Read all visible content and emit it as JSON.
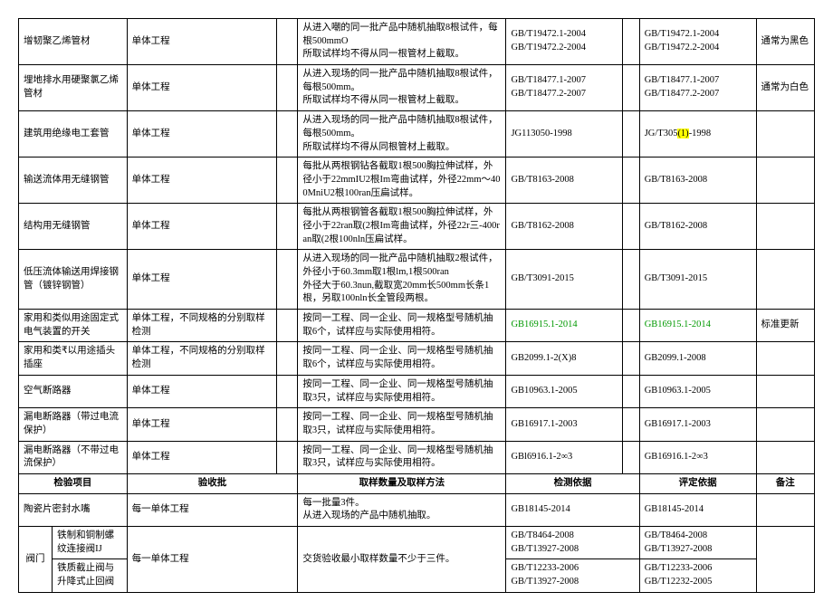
{
  "rows": [
    {
      "c1": "增韧聚乙烯管材",
      "c2": "单体工程",
      "c4": "从进入嘲的同一批产品中随机抽取8根试件，每根500mmO\n所取试样均不得从同一根管材上截取。",
      "c5": "GB/T19472.1-2004\nGB/T19472.2-2004",
      "c7": "GB/T19472.1-2004\nGB/T19472.2-2004",
      "c8": "通常为黑色"
    },
    {
      "c1": "埋地排水用硬聚氯乙烯管材",
      "c2": "单体工程",
      "c4": "从进入现场的同一批产品中随机抽取8根试件，每根500mm。\n所取试样均不得从同一根管材上截取。",
      "c5": "GB/T18477.1-2007\nGB/T18477.2-2007",
      "c7": "GB/T18477.1-2007\nGB/T18477.2-2007",
      "c8": "通常为白色"
    },
    {
      "c1": "建筑用绝缘电工套管",
      "c2": "单体工程",
      "c4": "从进入现场的同一批产品中随机抽取8根试件，每根500mm。\n所取试样均不得从同根管材上截取。",
      "c5": "JG113050-1998",
      "c7": "JG/T305(1)-1998",
      "c7_highlight": true,
      "c8": ""
    },
    {
      "c1": "输送流体用无缝钢管",
      "c2": "单体工程",
      "c4": "每批从两根钢钻各截取1根500胸拉伸试样，外径小于22mmIU2根Im弯曲试样，外径22mm～400MniU2根100ran压扁试样。",
      "c5": "GB/T8163-2008",
      "c7": "GB/T8163-2008",
      "c8": ""
    },
    {
      "c1": "结构用无缝钢管",
      "c2": "单体工程",
      "c4": "每批从两根钢管各截取1根500胸拉伸试样，外径小于22ran取(2根Im弯曲试样，外径22r三-400ran取(2根100nln压扁试样。",
      "c5": "GB/T8162-2008",
      "c7": "GB/T8162-2008",
      "c8": ""
    },
    {
      "c1": "低压流体输送用焊接钢管（镀锌钢管）",
      "c2": "单体工程",
      "c4": "从进入现场的同一批产品中随机抽取2根试件，外径小于60.3mm取1根lm,1根500ran\n外径大于60.3nun,截取宽20mm长500mm长条1根，另取100nln长全管段两根。",
      "c5": "GB/T3091-2015",
      "c7": "GB/T3091-2015",
      "c8": ""
    },
    {
      "c1": "家用和类似用途固定式电气装置的开关",
      "c2": "单体工程，不同规格的分别取样检测",
      "c4": "按同一工程、同一企业、同一规格型号随机抽取6个，试样应与实际使用相符。",
      "c5": "GB16915.1-2014",
      "c5_green": true,
      "c7": "GB16915.1-2014",
      "c7_green": true,
      "c8": "标准更新"
    },
    {
      "c1": "家用和类₹以用途插头插座",
      "c2": "单体工程，不同规格的分别取样检测",
      "c4": "按同一工程、同一企业、同一规格型号随机抽取6个，试样应与实际使用相符。",
      "c5": "GB2099.1-2(X)8",
      "c7": "GB2099.1-2008",
      "c8": ""
    },
    {
      "c1": "空气断路器",
      "c2": "单体工程",
      "c4": "按同一工程、同一企业、同一规格型号随机抽取3只，试样应与实际使用相符。",
      "c5": "GB10963.1-2005",
      "c7": "GB10963.1-2005",
      "c8": ""
    },
    {
      "c1": "漏电断路器（带过电流保护）",
      "c2": "单体工程",
      "c4": "按同一工程、同一企业、同一规格型号随机抽取3只，试样应与实际使用相符。",
      "c5": "GB16917.1-2003",
      "c7": "GB16917.1-2003",
      "c8": ""
    },
    {
      "c1": "漏电断路器（不带过电流保护）",
      "c2": "单体工程",
      "c4": "按同一工程、同一企业、同一规格型号随机抽取3只，试样应与实际使用相符。",
      "c5": "GBl6916.1-2∞3",
      "c7": "GB16916.1-2∞3",
      "c8": ""
    }
  ],
  "header2": {
    "c1": "检验项目",
    "c2": "验收批",
    "c4": "取样数量及取样方法",
    "c5": "检测依据",
    "c7": "评定依据",
    "c8": "备注"
  },
  "row12": {
    "c1": "陶瓷片密封水嘴",
    "c2": "每一单体工程",
    "c4": "每一批量3件。\n从进入现场的产品中随机抽取。",
    "c5": "GB18145-2014",
    "c7": "GB18145-2014"
  },
  "row13": {
    "cat": "阀门",
    "sub1": "铁制和铜制螺纹连接阀IJ",
    "sub2": "铁质截止阀与升降式止回阀",
    "c2": "每一单体工程",
    "c4": "交货验收最小取样数量不少于三件。",
    "c5": "GB/T8464-2008\nGB/T13927-2008\nGB/T12233-2006\nGB/T13927-2008",
    "c7": "GB/T8464-2008\nGB/T13927-2008\nGB/T12233-2006\nGB/T12232-2005"
  }
}
